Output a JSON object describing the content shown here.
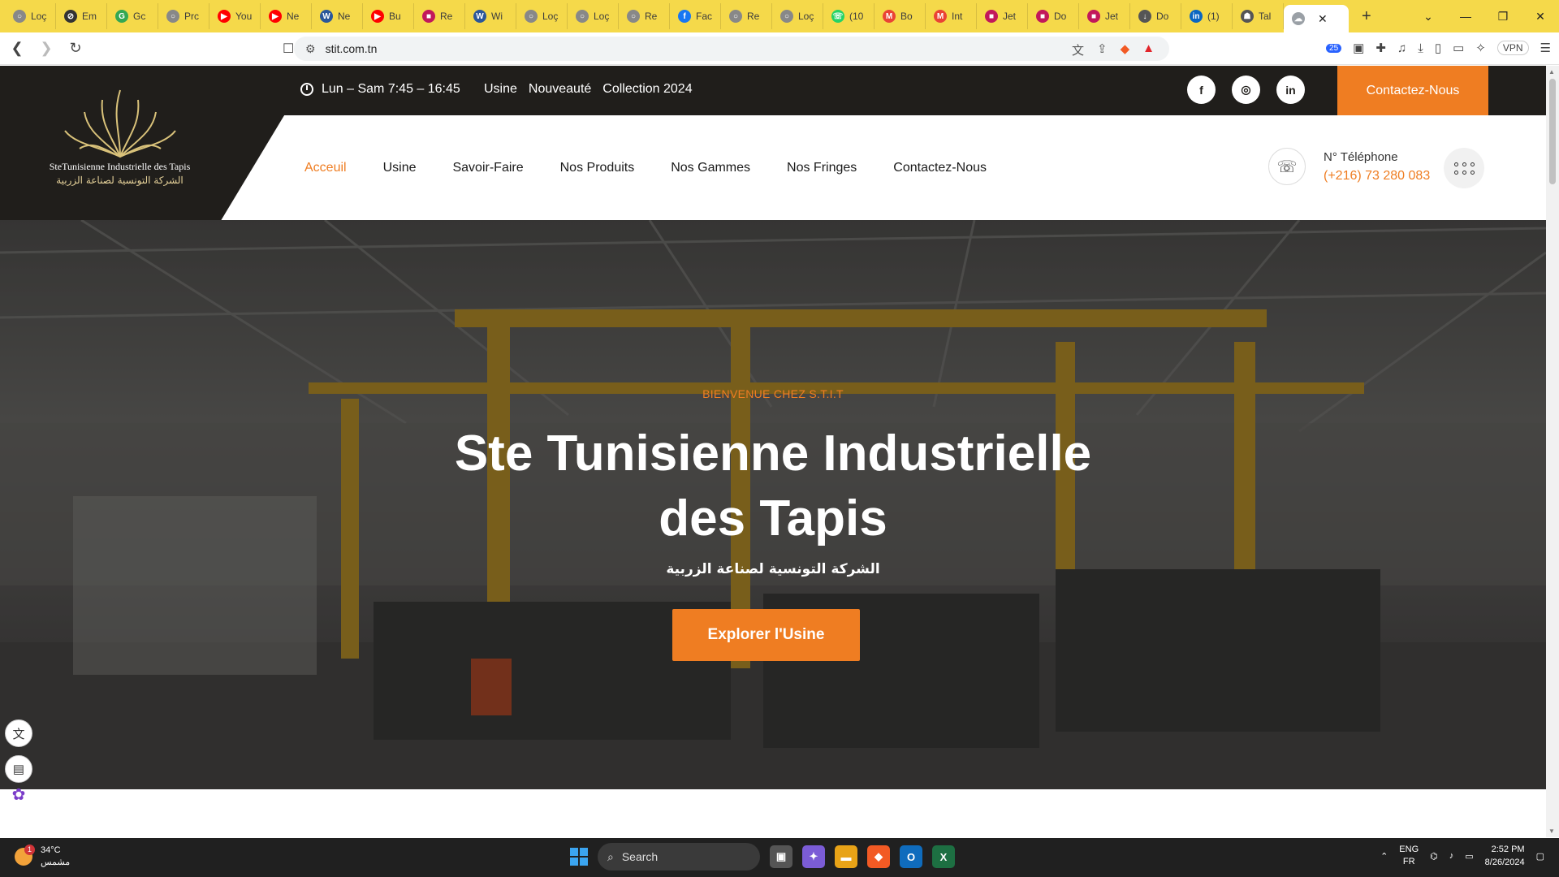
{
  "browser": {
    "tabs": [
      {
        "label": "Loç",
        "color": "#888888",
        "glyph": "○"
      },
      {
        "label": "Em",
        "color": "#333333",
        "glyph": "⊘"
      },
      {
        "label": "Gc",
        "color": "#34a853",
        "glyph": "G"
      },
      {
        "label": "Prc",
        "color": "#888888",
        "glyph": "○"
      },
      {
        "label": "You",
        "color": "#ff0000",
        "glyph": "▶"
      },
      {
        "label": "Ne",
        "color": "#ff0000",
        "glyph": "▶"
      },
      {
        "label": "Ne",
        "color": "#2b579a",
        "glyph": "W"
      },
      {
        "label": "Bu",
        "color": "#ff0000",
        "glyph": "▶"
      },
      {
        "label": "Re",
        "color": "#c2185b",
        "glyph": "■"
      },
      {
        "label": "Wi",
        "color": "#2b579a",
        "glyph": "W"
      },
      {
        "label": "Loç",
        "color": "#888888",
        "glyph": "○"
      },
      {
        "label": "Loç",
        "color": "#888888",
        "glyph": "○"
      },
      {
        "label": "Re",
        "color": "#888888",
        "glyph": "○"
      },
      {
        "label": "Fac",
        "color": "#1877f2",
        "glyph": "f"
      },
      {
        "label": "Re",
        "color": "#888888",
        "glyph": "○"
      },
      {
        "label": "Loç",
        "color": "#888888",
        "glyph": "○"
      },
      {
        "label": "(10",
        "color": "#25d366",
        "glyph": "☏"
      },
      {
        "label": "Bo",
        "color": "#ea4335",
        "glyph": "M"
      },
      {
        "label": "Int",
        "color": "#ea4335",
        "glyph": "M"
      },
      {
        "label": "Jet",
        "color": "#c2185b",
        "glyph": "■"
      },
      {
        "label": "Do",
        "color": "#c2185b",
        "glyph": "■"
      },
      {
        "label": "Jet",
        "color": "#c2185b",
        "glyph": "■"
      },
      {
        "label": "Do",
        "color": "#555555",
        "glyph": "↓"
      },
      {
        "label": "(1)",
        "color": "#0a66c2",
        "glyph": "in"
      },
      {
        "label": "Tal",
        "color": "#555555",
        "glyph": "☗"
      }
    ],
    "active_tab": {
      "label": "",
      "glyph": "☁",
      "close": "✕"
    },
    "new_tab": "+",
    "window_controls": {
      "dropdown": "⌄",
      "minimize": "—",
      "maximize": "❐",
      "close": "✕"
    },
    "url": "stit.com.tn",
    "vpn_label": "VPN",
    "ext_badge": "25"
  },
  "site": {
    "topbar": {
      "hours": "Lun – Sam 7:45 – 16:45",
      "links": [
        "Usine",
        "Nouveauté",
        "Collection 2024"
      ],
      "socials": [
        {
          "name": "facebook-icon",
          "glyph": "f"
        },
        {
          "name": "instagram-icon",
          "glyph": "◎"
        },
        {
          "name": "linkedin-icon",
          "glyph": "in"
        }
      ],
      "cta": "Contactez-Nous"
    },
    "logo": {
      "text_en": "SteTunisienne Industrielle des Tapis",
      "text_ar": "الشركة التونسية لصناعة الزربية"
    },
    "nav": [
      "Acceuil",
      "Usine",
      "Savoir-Faire",
      "Nos Produits",
      "Nos Gammes",
      "Nos Fringes",
      "Contactez-Nous"
    ],
    "phone": {
      "label": "N° Téléphone",
      "number": "(+216) 73 280 083"
    },
    "hero": {
      "eyebrow": "BIENVENUE CHEZ S.T.I.T",
      "title": "Ste Tunisienne Industrielle des Tapis",
      "subtitle_ar": "الشركة التونسية لصناعة الزربية",
      "button": "Explorer l'Usine"
    }
  },
  "taskbar": {
    "weather_temp": "34°C",
    "weather_desc": "مشمس",
    "weather_badge": "1",
    "search_label": "Search",
    "lang_1": "ENG",
    "lang_2": "FR",
    "time": "2:52 PM",
    "date": "8/26/2024"
  },
  "colors": {
    "accent": "#ef7d22",
    "dark": "#201e1b",
    "tabbar": "#f5d94a"
  }
}
